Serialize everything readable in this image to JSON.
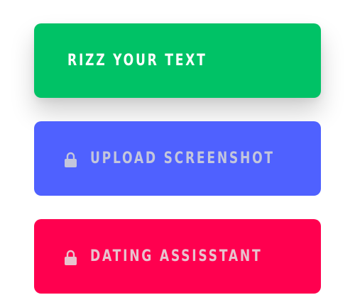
{
  "menu": {
    "buttons": [
      {
        "label": "RIZZ YOUR TEXT",
        "background": "#00C266",
        "text_color": "#FFFFFF",
        "locked": false
      },
      {
        "label": "UPLOAD SCREENSHOT",
        "background": "#4F61FF",
        "text_color": "#C3C6DC",
        "locked": true,
        "icon": "lock-icon"
      },
      {
        "label": "DATING ASSISSTANT",
        "background": "#FF004F",
        "text_color": "#E8C3CE",
        "locked": true,
        "icon": "lock-icon"
      }
    ]
  }
}
